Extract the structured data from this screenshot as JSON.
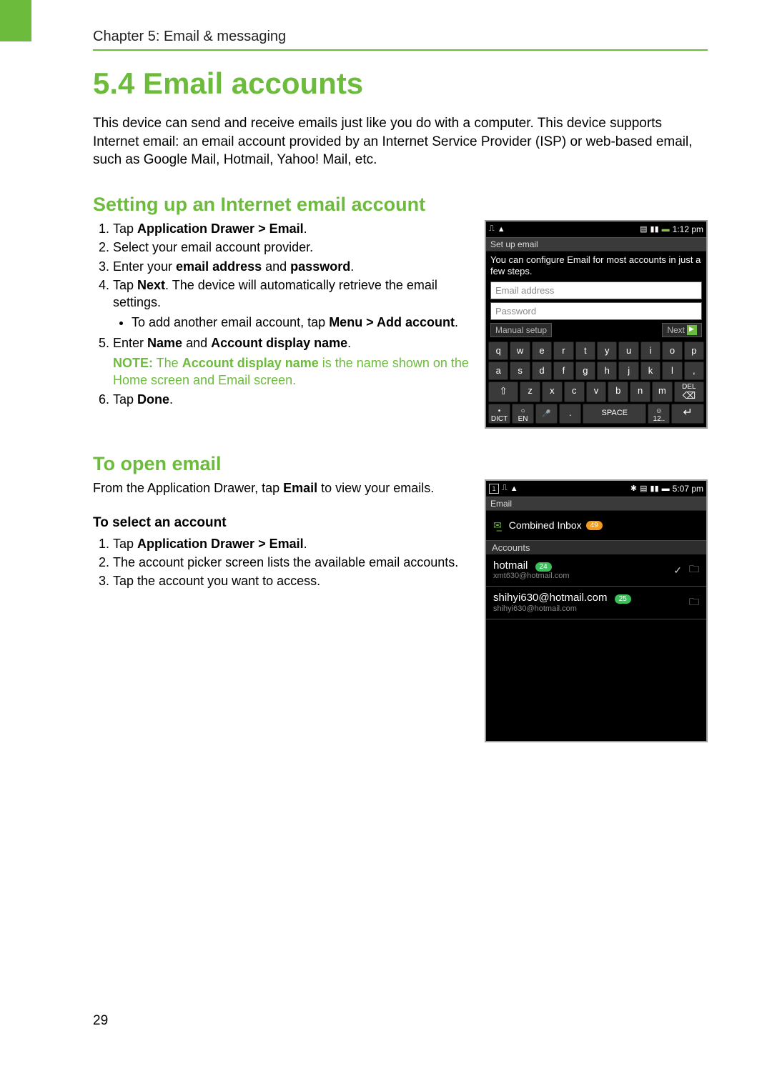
{
  "header": {
    "chapter": "Chapter 5: Email & messaging"
  },
  "title": "5.4 Email accounts",
  "intro": "This device can send and receive emails just like you do with a computer. This device supports Internet email: an email account provided by an Internet Service Provider (ISP) or web-based email, such as Google Mail, Hotmail, Yahoo! Mail, etc.",
  "section1": {
    "heading": "Setting up an Internet email account",
    "steps": {
      "s1_a": "Tap ",
      "s1_b": "Application Drawer > Email",
      "s1_c": ".",
      "s2": "Select your email account provider.",
      "s3_a": "Enter your ",
      "s3_b": "email address",
      "s3_c": " and ",
      "s3_d": "password",
      "s3_e": ".",
      "s4_a": "Tap ",
      "s4_b": "Next",
      "s4_c": ". The device will automatically retrieve the email settings.",
      "s4_bullet_a": "To add another email account, tap ",
      "s4_bullet_b": "Menu > Add account",
      "s4_bullet_c": ".",
      "s5_a": "Enter ",
      "s5_b": "Name",
      "s5_c": " and ",
      "s5_d": "Account display name",
      "s5_e": ".",
      "note_label": "NOTE:",
      "note_a": " The ",
      "note_b": "Account display name",
      "note_c": " is the name shown on the Home screen and Email screen.",
      "s6_a": "Tap ",
      "s6_b": "Done",
      "s6_c": "."
    }
  },
  "section2": {
    "heading": "To open email",
    "lead_a": "From the Application Drawer, tap ",
    "lead_b": "Email",
    "lead_c": " to view your emails.",
    "sub": "To select an account",
    "steps": {
      "s1_a": "Tap ",
      "s1_b": "Application Drawer > Email",
      "s1_c": ".",
      "s2": "The account picker screen lists the available email accounts.",
      "s3": "Tap the account you want to access."
    }
  },
  "phone1": {
    "time": "1:12 pm",
    "subbar": "Set up email",
    "msg": "You can configure Email for most accounts in just a few steps.",
    "email_ph": "Email address",
    "pwd_ph": "Password",
    "manual": "Manual setup",
    "next": "Next",
    "keys": {
      "r1": [
        "q",
        "w",
        "e",
        "r",
        "t",
        "y",
        "u",
        "i",
        "o",
        "p"
      ],
      "r2": [
        "a",
        "s",
        "d",
        "f",
        "g",
        "h",
        "j",
        "k",
        "l",
        ","
      ],
      "r3_mid": [
        "z",
        "x",
        "c",
        "v",
        "b",
        "n",
        "m"
      ],
      "del": "DEL",
      "dict_top": "•",
      "dict_bot": "DICT",
      "en_top": "○",
      "en_bot": "EN",
      "dot": ".",
      "space": "SPACE",
      "num_bot": "12.."
    }
  },
  "phone2": {
    "time": "5:07 pm",
    "subbar": "Email",
    "combined": "Combined Inbox",
    "combined_badge": "49",
    "accounts_hdr": "Accounts",
    "acct1": {
      "name": "hotmail",
      "email": "xmt630@hotmail.com",
      "badge": "24"
    },
    "acct2": {
      "name": "shihyi630@hotmail.com",
      "email": "shihyi630@hotmail.com",
      "badge": "25"
    }
  },
  "page_number": "29"
}
